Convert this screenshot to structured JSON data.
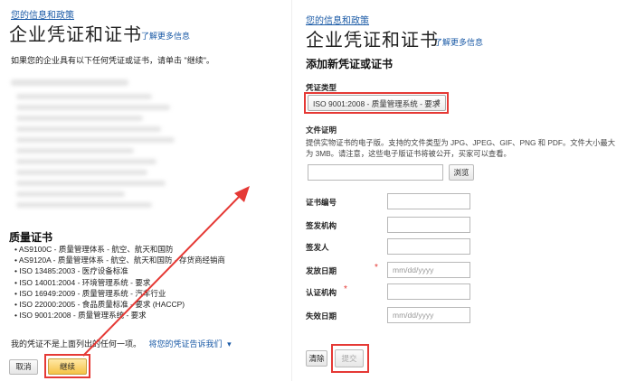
{
  "left": {
    "breadcrumb": "您的信息和政策",
    "title": "企业凭证和证书",
    "learn_more": "了解更多信息",
    "instruction": "如果您的企业具有以下任何凭证或证书，请单击 \"继续\"。",
    "quality_heading": "质量证书",
    "quality_certs": [
      "AS9100C - 质量管理体系 - 航空、航天和国防",
      "AS9120A - 质量管理体系 - 航空、航天和国防 - 存货商经销商",
      "ISO 13485:2003 - 医疗设备标准",
      "ISO 14001:2004 - 环境管理系统 - 要求",
      "ISO 16949:2009 - 质量管理系统 - 汽车行业",
      "ISO 22000:2005 - 食品质量标准 - 要求 (HACCP)",
      "ISO 9001:2008 - 质量管理系统 - 要求"
    ],
    "not_listed_text": "我的凭证不是上面列出的任何一项。",
    "tell_us_link": "将您的凭证告诉我们",
    "cancel_label": "取消",
    "continue_label": "继续"
  },
  "right": {
    "breadcrumb": "您的信息和政策",
    "title": "企业凭证和证书",
    "learn_more": "了解更多信息",
    "form_heading": "添加新凭证或证书",
    "cert_type_label": "凭证类型",
    "cert_type_value": "ISO 9001:2008 - 质量管理系统 - 要求",
    "file_proof_label": "文件证明",
    "file_desc": "提供实物证书的电子版。支持的文件类型为 JPG、JPEG、GIF、PNG 和 PDF。文件大小最大为 3MB。请注意，这些电子版证书将被公开，买家可以查看。",
    "browse_label": "浏览",
    "fields": [
      {
        "label": "证书编号",
        "placeholder": "",
        "required": false
      },
      {
        "label": "签发机构",
        "placeholder": "",
        "required": false
      },
      {
        "label": "签发人",
        "placeholder": "",
        "required": false
      },
      {
        "label": "发放日期",
        "placeholder": "mm/dd/yyyy",
        "required": true
      },
      {
        "label": "认证机构",
        "placeholder": "",
        "required": true
      },
      {
        "label": "失效日期",
        "placeholder": "mm/dd/yyyy",
        "required": false
      }
    ],
    "clear_label": "清除",
    "submit_label": "提交"
  },
  "colors": {
    "link": "#1a5aa6",
    "highlight": "#e53935",
    "primary_button": "#f5c246"
  }
}
